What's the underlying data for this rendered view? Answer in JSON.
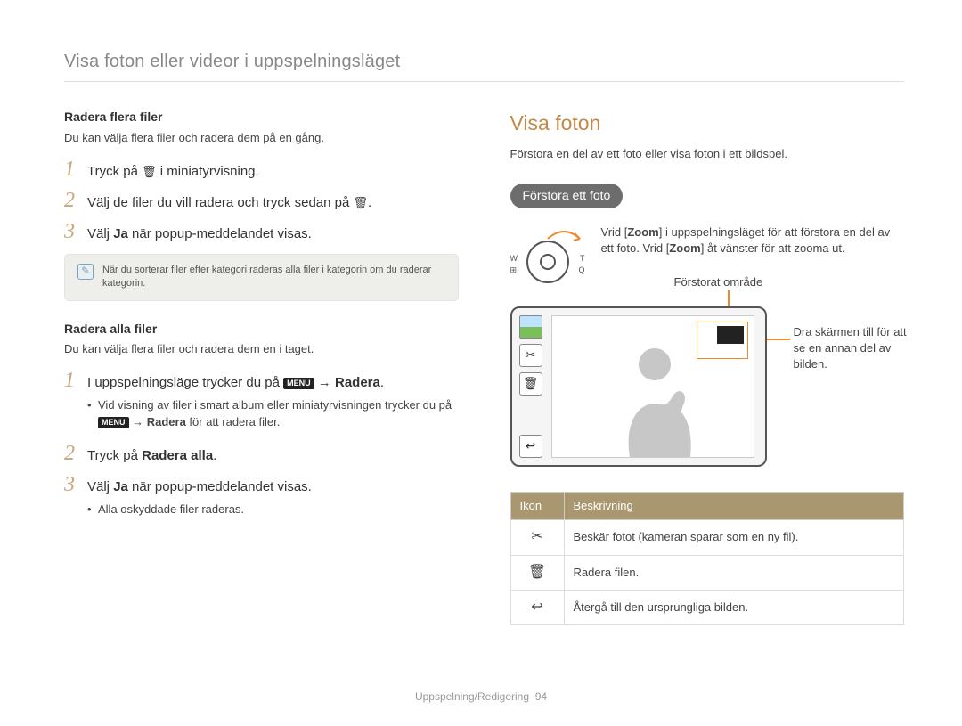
{
  "header": {
    "title": "Visa foton eller videor i uppspelningsläget"
  },
  "left": {
    "sec1": {
      "heading": "Radera flera filer",
      "intro": "Du kan välja flera filer och radera dem på en gång.",
      "step1_a": "Tryck på ",
      "step1_b": " i miniatyrvisning.",
      "step2_a": "Välj de filer du vill radera och tryck sedan på ",
      "step2_b": ".",
      "step3_a": "Välj ",
      "step3_bold": "Ja",
      "step3_b": " när popup-meddelandet visas.",
      "note": "När du sorterar filer efter kategori raderas alla filer i kategorin om du raderar kategorin."
    },
    "sec2": {
      "heading": "Radera alla filer",
      "intro": "Du kan välja flera filer och radera dem en i taget.",
      "s1_a": "I uppspelningsläge trycker du på ",
      "s1_arrow": " → ",
      "s1_bold": "Radera",
      "s1_end": ".",
      "s1_sub_a": "Vid visning av filer i smart album eller miniatyrvisningen trycker du på ",
      "s1_sub_arrow": " → ",
      "s1_sub_bold": "Radera",
      "s1_sub_end": " för att radera filer.",
      "s2_a": "Tryck på ",
      "s2_bold": "Radera alla",
      "s2_end": ".",
      "s3_a": "Välj ",
      "s3_bold": "Ja",
      "s3_b": " när popup-meddelandet visas.",
      "s3_sub": "Alla oskyddade filer raderas."
    }
  },
  "right": {
    "title": "Visa foton",
    "intro": "Förstora en del av ett foto eller visa foton i ett bildspel.",
    "pill": "Förstora ett foto",
    "zoom_a": "Vrid [",
    "zoom_b1": "Zoom",
    "zoom_c": "] i uppspelningsläget för att förstora en del av ett foto. Vrid [",
    "zoom_b2": "Zoom",
    "zoom_d": "] åt vänster för att zooma ut.",
    "dial_left_1": "W",
    "dial_left_2": "⊞",
    "dial_right_1": "T",
    "dial_right_2": "Q",
    "hint_top": "Förstorat område",
    "hint_right": "Dra skärmen till för att se en annan del av bilden.",
    "table": {
      "h1": "Ikon",
      "h2": "Beskrivning",
      "r1": "Beskär fotot (kameran sparar som en ny fil).",
      "r2": "Radera filen.",
      "r3": "Återgå till den ursprungliga bilden."
    }
  },
  "icons": {
    "trash": "🗑",
    "scissors": "✂",
    "back": "↩",
    "menu": "MENU"
  },
  "footer": {
    "label": "Uppspelning/Redigering",
    "page": "94"
  }
}
